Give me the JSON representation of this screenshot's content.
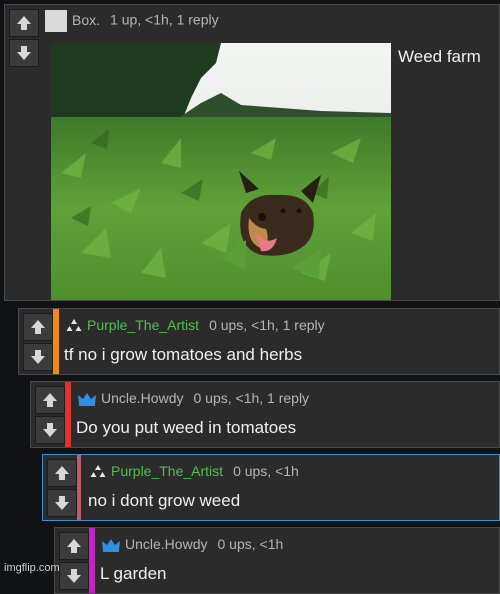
{
  "comments": [
    {
      "user": "Box.",
      "meta": "1 up, <1h, 1 reply",
      "text": "Weed farm"
    },
    {
      "user": "Purple_The_Artist",
      "meta": "0 ups, <1h, 1 reply",
      "text": "tf no i grow tomatoes and herbs",
      "accent_color": "#f08a14"
    },
    {
      "user": "Uncle.Howdy",
      "meta": "0 ups, <1h, 1 reply",
      "text": "Do you put weed in tomatoes",
      "accent_color": "#e3322d"
    },
    {
      "user": "Purple_The_Artist",
      "meta": "0 ups, <1h",
      "text": "no i dont grow weed",
      "accent_color": "#c45a66"
    },
    {
      "user": "Uncle.Howdy",
      "meta": "0 ups, <1h",
      "text": "L garden",
      "accent_color": "#c324c4"
    }
  ],
  "icons": {
    "upvote": "arrow-up-icon",
    "downvote": "arrow-down-icon",
    "triforce": "triforce-icon",
    "crown": "crown-icon"
  },
  "colors": {
    "username_green": "#4fc24c",
    "crown_blue": "#2f8fe0"
  },
  "watermark": "imgflip.com"
}
